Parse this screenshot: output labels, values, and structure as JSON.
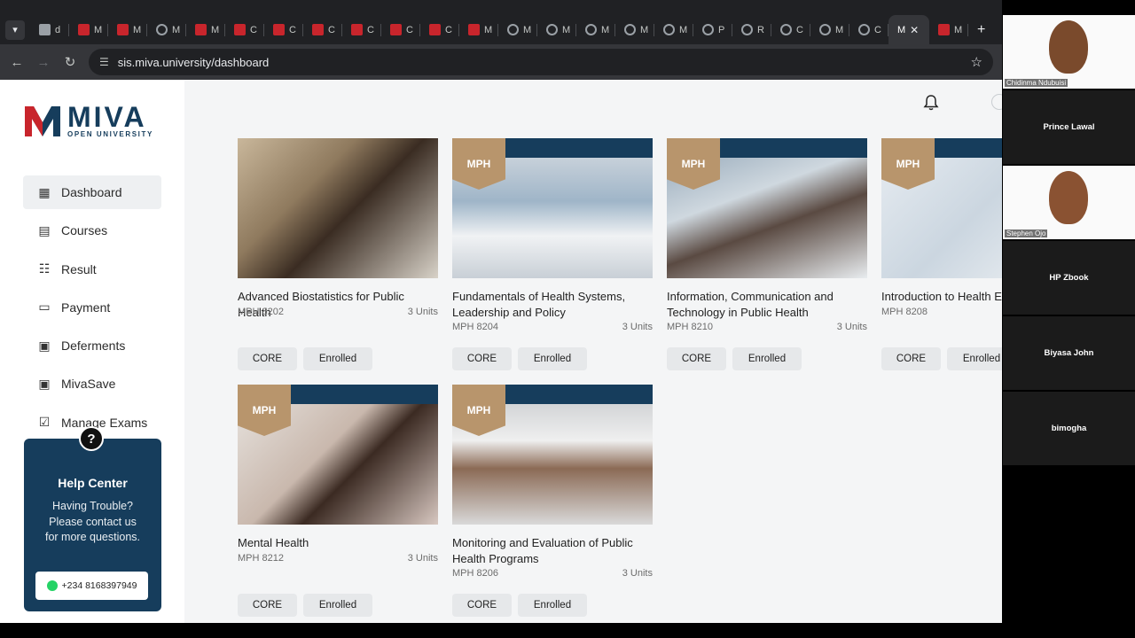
{
  "browser": {
    "tabs": [
      {
        "label": "d",
        "icon": "doc-favicon"
      },
      {
        "label": "M",
        "icon": "miva-favicon"
      },
      {
        "label": "M",
        "icon": "miva-favicon"
      },
      {
        "label": "M",
        "icon": "globe-favicon"
      },
      {
        "label": "M",
        "icon": "miva-favicon"
      },
      {
        "label": "C",
        "icon": "miva-favicon"
      },
      {
        "label": "C",
        "icon": "miva-favicon"
      },
      {
        "label": "C",
        "icon": "miva-favicon"
      },
      {
        "label": "C",
        "icon": "miva-favicon"
      },
      {
        "label": "C",
        "icon": "miva-favicon"
      },
      {
        "label": "C",
        "icon": "miva-favicon"
      },
      {
        "label": "M",
        "icon": "miva-favicon"
      },
      {
        "label": "M",
        "icon": "globe-favicon"
      },
      {
        "label": "M",
        "icon": "globe-favicon"
      },
      {
        "label": "M",
        "icon": "globe-favicon"
      },
      {
        "label": "M",
        "icon": "globe-favicon"
      },
      {
        "label": "M",
        "icon": "globe-favicon"
      },
      {
        "label": "P",
        "icon": "globe-favicon"
      },
      {
        "label": "R",
        "icon": "globe-favicon"
      },
      {
        "label": "C",
        "icon": "globe-favicon"
      },
      {
        "label": "M",
        "icon": "globe-favicon"
      },
      {
        "label": "C",
        "icon": "globe-favicon"
      },
      {
        "label": "M",
        "icon": "active-tab"
      },
      {
        "label": "M",
        "icon": "miva-favicon"
      }
    ],
    "url": "sis.miva.university/dashboard"
  },
  "brand": {
    "name": "MIVA",
    "subtitle": "OPEN UNIVERSITY",
    "primary_color": "#163d5c",
    "accent_color": "#c8252c",
    "ribbon_color": "#b8956c"
  },
  "sidebar": {
    "items": [
      {
        "label": "Dashboard",
        "icon": "dashboard-icon",
        "active": true
      },
      {
        "label": "Courses",
        "icon": "courses-icon"
      },
      {
        "label": "Result",
        "icon": "result-icon"
      },
      {
        "label": "Payment",
        "icon": "payment-icon"
      },
      {
        "label": "Deferments",
        "icon": "deferments-icon"
      },
      {
        "label": "MivaSave",
        "icon": "mivasave-icon"
      },
      {
        "label": "Manage Exams",
        "icon": "exams-icon"
      }
    ]
  },
  "help": {
    "title": "Help Center",
    "text_lines": [
      "Having Trouble?",
      "Please contact us",
      "for more questions."
    ],
    "phone": "+234 8168397949"
  },
  "courses": [
    {
      "title": "Advanced Biostatistics for Public Health",
      "code": "MPH 8202",
      "units": "3 Units",
      "tag": "CORE",
      "status": "Enrolled",
      "ribbon": ""
    },
    {
      "title": "Fundamentals of Health Systems, Leadership and Policy",
      "code": "MPH 8204",
      "units": "3 Units",
      "tag": "CORE",
      "status": "Enrolled",
      "ribbon": "MPH"
    },
    {
      "title": "Information, Communication and Technology in Public Health",
      "code": "MPH 8210",
      "units": "3 Units",
      "tag": "CORE",
      "status": "Enrolled",
      "ribbon": "MPH"
    },
    {
      "title": "Introduction to Health Ec",
      "code": "MPH 8208",
      "units": "",
      "tag": "CORE",
      "status": "Enrolled",
      "ribbon": "MPH"
    },
    {
      "title": "Mental Health",
      "code": "MPH 8212",
      "units": "3 Units",
      "tag": "CORE",
      "status": "Enrolled",
      "ribbon": "MPH"
    },
    {
      "title": "Monitoring and Evaluation of Public Health Programs",
      "code": "MPH 8206",
      "units": "3 Units",
      "tag": "CORE",
      "status": "Enrolled",
      "ribbon": "MPH"
    }
  ],
  "participants": [
    {
      "name": "Chidinma Ndubuisi",
      "has_video": true
    },
    {
      "name": "Prince Lawal",
      "has_video": false
    },
    {
      "name": "Stephen Ojo",
      "has_video": true
    },
    {
      "name": "HP Zbook",
      "has_video": false
    },
    {
      "name": "Biyasa John",
      "has_video": false
    },
    {
      "name": "bimogha",
      "has_video": false
    }
  ]
}
